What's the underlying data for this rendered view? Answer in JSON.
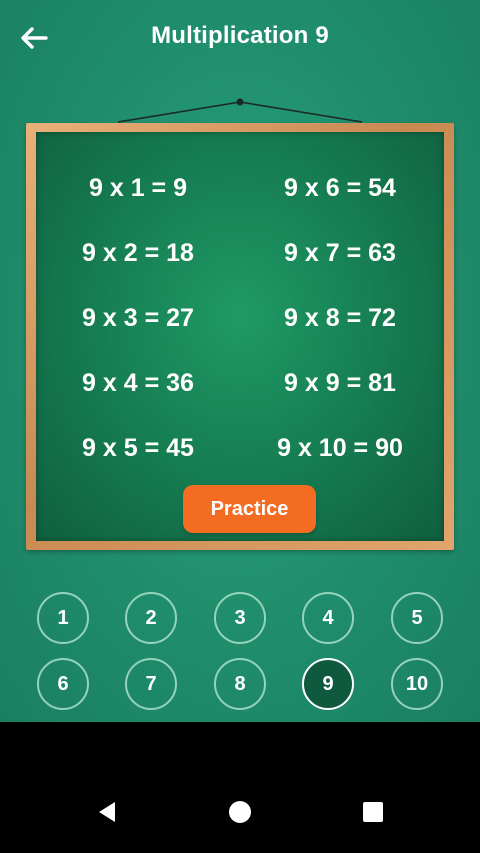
{
  "header": {
    "title": "Multiplication 9"
  },
  "facts_left": [
    "9 x 1 = 9",
    "9 x 2 = 18",
    "9 x 3 = 27",
    "9 x 4 = 36",
    "9 x 5 = 45"
  ],
  "facts_right": [
    "9 x 6 = 54",
    "9 x 7 = 63",
    "9 x 8 = 72",
    "9 x 9 = 81",
    "9 x 10 = 90"
  ],
  "practice_label": "Practice",
  "numbers": [
    "1",
    "2",
    "3",
    "4",
    "5",
    "6",
    "7",
    "8",
    "9",
    "10"
  ],
  "selected_number": "9",
  "colors": {
    "background": "#1f8a6a",
    "board": "#157a50",
    "frame": "#d9995f",
    "accent": "#f36c21"
  },
  "icons": {
    "back": "arrow-left-icon",
    "nav_back": "triangle-back-icon",
    "nav_home": "circle-home-icon",
    "nav_recents": "square-recents-icon"
  }
}
